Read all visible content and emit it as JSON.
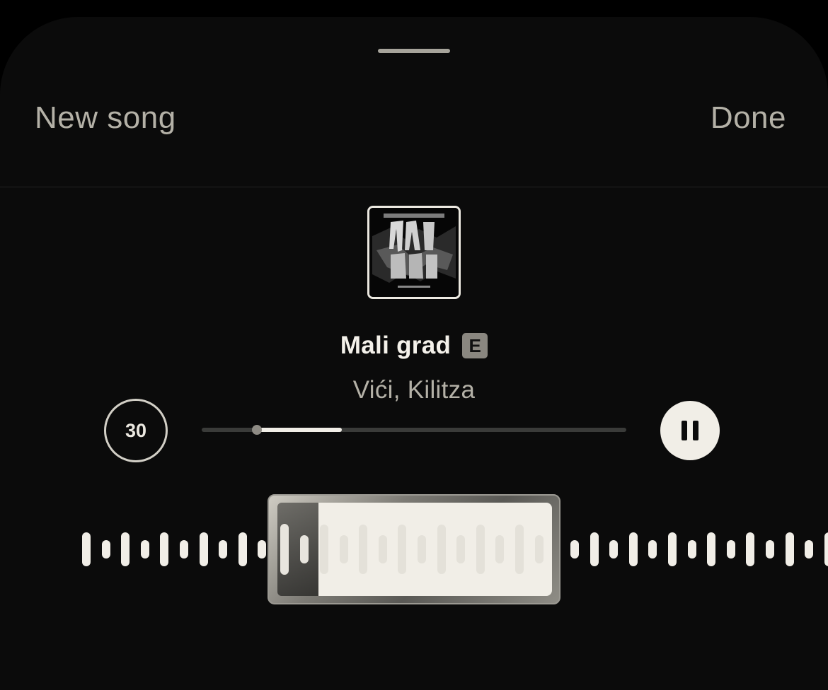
{
  "header": {
    "new_song_label": "New song",
    "done_label": "Done"
  },
  "track": {
    "title": "Mali grad",
    "explicit_badge": "E",
    "artist": "Vići, Kilitza",
    "album_art_text": "MALI GRAD"
  },
  "player": {
    "duration_label": "30",
    "progress_fraction": 0.13,
    "selection_start_fraction": 0.13,
    "state": "playing"
  },
  "colors": {
    "background": "#0b0b0b",
    "accent": "#f1eee7",
    "muted_text": "#b4b1a7"
  },
  "icons": {
    "pause": "pause-icon",
    "explicit": "explicit-icon"
  }
}
